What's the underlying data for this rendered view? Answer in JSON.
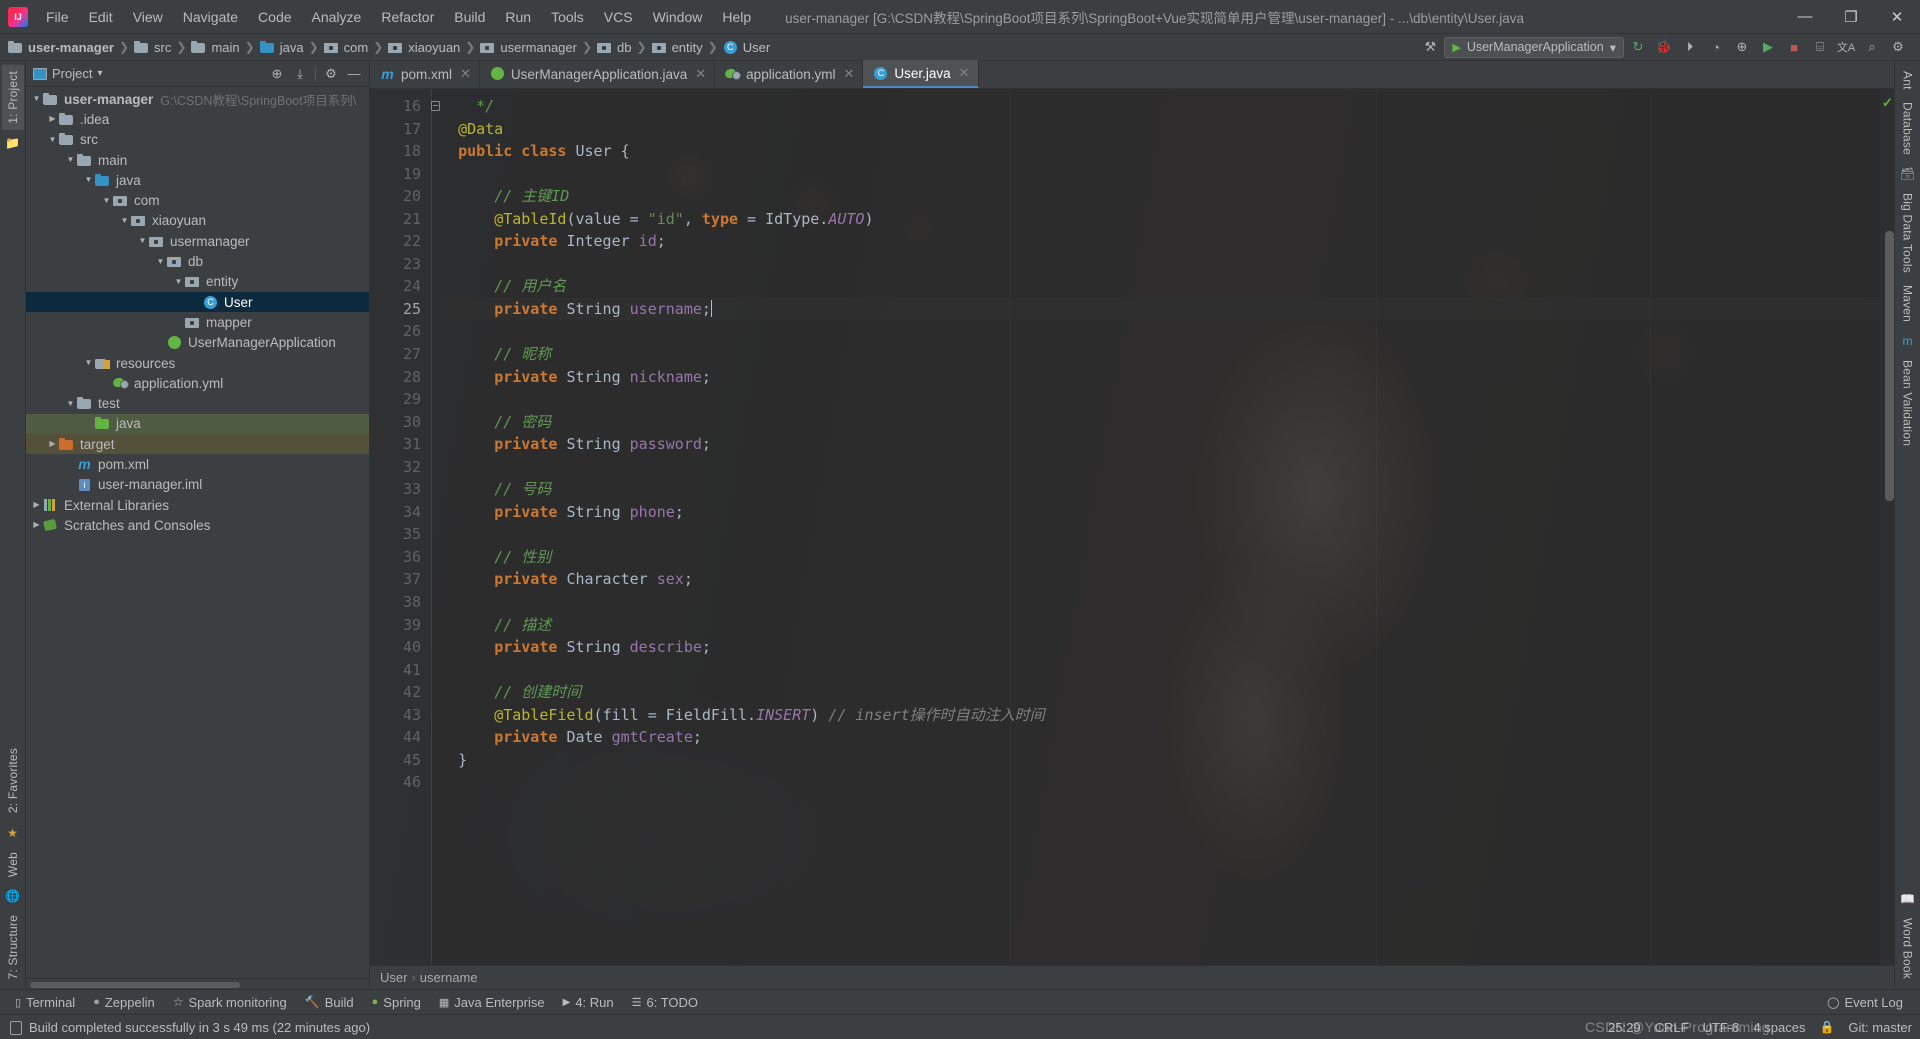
{
  "window": {
    "title": "user-manager [G:\\CSDN教程\\SpringBoot项目系列\\SpringBoot+Vue实现简单用户管理\\user-manager] - ...\\db\\entity\\User.java",
    "minimize_label": "—",
    "maximize_label": "❐",
    "close_label": "✕",
    "logo_name": "intellij-idea-logo"
  },
  "menu": [
    {
      "label": "File"
    },
    {
      "label": "Edit"
    },
    {
      "label": "View"
    },
    {
      "label": "Navigate"
    },
    {
      "label": "Code"
    },
    {
      "label": "Analyze"
    },
    {
      "label": "Refactor"
    },
    {
      "label": "Build"
    },
    {
      "label": "Run"
    },
    {
      "label": "Tools"
    },
    {
      "label": "VCS"
    },
    {
      "label": "Window"
    },
    {
      "label": "Help"
    }
  ],
  "breadcrumbs": [
    {
      "label": "user-manager",
      "icon": "folder-module",
      "bold": true
    },
    {
      "label": "src",
      "icon": "folder"
    },
    {
      "label": "main",
      "icon": "folder"
    },
    {
      "label": "java",
      "icon": "folder-source"
    },
    {
      "label": "com",
      "icon": "package"
    },
    {
      "label": "xiaoyuan",
      "icon": "package"
    },
    {
      "label": "usermanager",
      "icon": "package"
    },
    {
      "label": "db",
      "icon": "package"
    },
    {
      "label": "entity",
      "icon": "package"
    },
    {
      "label": "User",
      "icon": "class"
    }
  ],
  "toolbar": {
    "run_config": "UserManagerApplication",
    "run_config_caret": "▾",
    "icons": [
      {
        "name": "hammer-build-icon",
        "glyph": "⚒"
      },
      {
        "name": "update-project-icon",
        "glyph": "↻"
      },
      {
        "name": "debug-bug-icon",
        "glyph": "🐞"
      },
      {
        "name": "run-with-coverage-icon",
        "glyph": "⏵"
      },
      {
        "name": "profile-icon",
        "glyph": "◔"
      },
      {
        "name": "attach-process-icon",
        "glyph": "⊕"
      },
      {
        "name": "run-icon",
        "glyph": "▶"
      },
      {
        "name": "stop-icon",
        "glyph": "■"
      },
      {
        "name": "layout-icon",
        "glyph": "⌸"
      },
      {
        "name": "translate-icon",
        "glyph": "文A"
      },
      {
        "name": "search-everywhere-icon",
        "glyph": "⌕"
      },
      {
        "name": "settings-gear-icon",
        "glyph": "⚙"
      }
    ]
  },
  "left_strip": {
    "top_tabs": [
      {
        "label": "1: Project",
        "active": true
      }
    ],
    "bottom_tabs": [
      {
        "label": "2: Favorites"
      },
      {
        "label": "Web"
      },
      {
        "label": "7: Structure"
      }
    ]
  },
  "right_strip": {
    "tabs": [
      {
        "label": "Ant"
      },
      {
        "label": "Database"
      },
      {
        "label": "Big Data Tools"
      },
      {
        "label": "Maven"
      },
      {
        "label": "Bean Validation"
      }
    ],
    "bottom_tabs": [
      {
        "label": "Word Book"
      }
    ]
  },
  "project_panel": {
    "title": "Project",
    "title_caret": "▾",
    "actions": [
      {
        "name": "locate-target-icon",
        "glyph": "⊕"
      },
      {
        "name": "collapse-all-icon",
        "glyph": "⤓"
      },
      {
        "name": "settings-gear-icon",
        "glyph": "⚙"
      },
      {
        "name": "hide-panel-icon",
        "glyph": "—"
      }
    ],
    "tree": [
      {
        "depth": 0,
        "label": "user-manager",
        "path": "G:\\CSDN教程\\SpringBoot项目系列\\",
        "icon": "folder-module",
        "arrow": "▼",
        "bold": true
      },
      {
        "depth": 1,
        "label": ".idea",
        "icon": "folder",
        "arrow": "▶"
      },
      {
        "depth": 1,
        "label": "src",
        "icon": "folder",
        "arrow": "▼"
      },
      {
        "depth": 2,
        "label": "main",
        "icon": "folder",
        "arrow": "▼"
      },
      {
        "depth": 3,
        "label": "java",
        "icon": "folder-source",
        "arrow": "▼"
      },
      {
        "depth": 4,
        "label": "com",
        "icon": "package",
        "arrow": "▼"
      },
      {
        "depth": 5,
        "label": "xiaoyuan",
        "icon": "package",
        "arrow": "▼"
      },
      {
        "depth": 6,
        "label": "usermanager",
        "icon": "package",
        "arrow": "▼"
      },
      {
        "depth": 7,
        "label": "db",
        "icon": "package",
        "arrow": "▼"
      },
      {
        "depth": 8,
        "label": "entity",
        "icon": "package",
        "arrow": "▼"
      },
      {
        "depth": 9,
        "label": "User",
        "icon": "class",
        "arrow": "",
        "selected": true
      },
      {
        "depth": 8,
        "label": "mapper",
        "icon": "package",
        "arrow": ""
      },
      {
        "depth": 7,
        "label": "UserManagerApplication",
        "icon": "spring-class",
        "arrow": ""
      },
      {
        "depth": 3,
        "label": "resources",
        "icon": "folder-resources",
        "arrow": "▼"
      },
      {
        "depth": 4,
        "label": "application.yml",
        "icon": "spring-yml",
        "arrow": ""
      },
      {
        "depth": 2,
        "label": "test",
        "icon": "folder",
        "arrow": "▼"
      },
      {
        "depth": 3,
        "label": "java",
        "icon": "folder-test",
        "arrow": "",
        "highlight": "green"
      },
      {
        "depth": 1,
        "label": "target",
        "icon": "folder-excluded",
        "arrow": "▶",
        "highlight": "olive"
      },
      {
        "depth": 1,
        "label": "pom.xml",
        "icon": "maven",
        "arrow": ""
      },
      {
        "depth": 1,
        "label": "user-manager.iml",
        "icon": "iml",
        "arrow": ""
      },
      {
        "depth": 0,
        "label": "External Libraries",
        "icon": "library",
        "arrow": "▶"
      },
      {
        "depth": 0,
        "label": "Scratches and Consoles",
        "icon": "scratch",
        "arrow": "▶"
      }
    ]
  },
  "editor_tabs": [
    {
      "label": "pom.xml",
      "icon": "maven-icon",
      "active": false,
      "close": "✕"
    },
    {
      "label": "UserManagerApplication.java",
      "icon": "spring-class-icon",
      "active": false,
      "close": "✕"
    },
    {
      "label": "application.yml",
      "icon": "spring-yml-icon",
      "active": false,
      "close": "✕"
    },
    {
      "label": "User.java",
      "icon": "java-class-icon",
      "active": true,
      "close": "✕"
    }
  ],
  "editor": {
    "first_line_number": 16,
    "current_line": 25,
    "inspection_status_glyph": "✓",
    "lines": [
      {
        "n": 16,
        "fold": true,
        "tokens": [
          {
            "t": "    ",
            "c": "pl"
          },
          {
            "t": "*/",
            "c": "cm"
          }
        ]
      },
      {
        "n": 17,
        "tokens": [
          {
            "t": "  ",
            "c": "pl"
          },
          {
            "t": "@Data",
            "c": "an"
          }
        ]
      },
      {
        "n": 18,
        "tokens": [
          {
            "t": "  ",
            "c": "pl"
          },
          {
            "t": "public class ",
            "c": "k"
          },
          {
            "t": "User ",
            "c": "ty"
          },
          {
            "t": "{",
            "c": "pl"
          }
        ]
      },
      {
        "n": 19,
        "tokens": []
      },
      {
        "n": 20,
        "tokens": [
          {
            "t": "      ",
            "c": "pl"
          },
          {
            "t": "// 主键ID",
            "c": "cm"
          }
        ]
      },
      {
        "n": 21,
        "tokens": [
          {
            "t": "      ",
            "c": "pl"
          },
          {
            "t": "@TableId",
            "c": "an"
          },
          {
            "t": "(",
            "c": "pl"
          },
          {
            "t": "value",
            "c": "pl"
          },
          {
            "t": " = ",
            "c": "pl"
          },
          {
            "t": "\"id\"",
            "c": "st"
          },
          {
            "t": ", ",
            "c": "pl"
          },
          {
            "t": "type",
            "c": "k"
          },
          {
            "t": " = ",
            "c": "pl"
          },
          {
            "t": "IdType.",
            "c": "pl"
          },
          {
            "t": "AUTO",
            "c": "it"
          },
          {
            "t": ")",
            "c": "pl"
          }
        ]
      },
      {
        "n": 22,
        "tokens": [
          {
            "t": "      ",
            "c": "pl"
          },
          {
            "t": "private ",
            "c": "k"
          },
          {
            "t": "Integer ",
            "c": "ty"
          },
          {
            "t": "id",
            "c": "fd"
          },
          {
            "t": ";",
            "c": "pl"
          }
        ]
      },
      {
        "n": 23,
        "tokens": []
      },
      {
        "n": 24,
        "tokens": [
          {
            "t": "      ",
            "c": "pl"
          },
          {
            "t": "// 用户名",
            "c": "cm"
          }
        ]
      },
      {
        "n": 25,
        "current": true,
        "tokens": [
          {
            "t": "      ",
            "c": "pl"
          },
          {
            "t": "private ",
            "c": "k"
          },
          {
            "t": "String ",
            "c": "ty"
          },
          {
            "t": "username",
            "c": "fd"
          },
          {
            "t": ";",
            "c": "pl"
          }
        ],
        "caret": true
      },
      {
        "n": 26,
        "tokens": []
      },
      {
        "n": 27,
        "tokens": [
          {
            "t": "      ",
            "c": "pl"
          },
          {
            "t": "// 昵称",
            "c": "cm"
          }
        ]
      },
      {
        "n": 28,
        "tokens": [
          {
            "t": "      ",
            "c": "pl"
          },
          {
            "t": "private ",
            "c": "k"
          },
          {
            "t": "String ",
            "c": "ty"
          },
          {
            "t": "nickname",
            "c": "fd"
          },
          {
            "t": ";",
            "c": "pl"
          }
        ]
      },
      {
        "n": 29,
        "tokens": []
      },
      {
        "n": 30,
        "tokens": [
          {
            "t": "      ",
            "c": "pl"
          },
          {
            "t": "// 密码",
            "c": "cm"
          }
        ]
      },
      {
        "n": 31,
        "tokens": [
          {
            "t": "      ",
            "c": "pl"
          },
          {
            "t": "private ",
            "c": "k"
          },
          {
            "t": "String ",
            "c": "ty"
          },
          {
            "t": "password",
            "c": "fd"
          },
          {
            "t": ";",
            "c": "pl"
          }
        ]
      },
      {
        "n": 32,
        "tokens": []
      },
      {
        "n": 33,
        "tokens": [
          {
            "t": "      ",
            "c": "pl"
          },
          {
            "t": "// 号码",
            "c": "cm"
          }
        ]
      },
      {
        "n": 34,
        "tokens": [
          {
            "t": "      ",
            "c": "pl"
          },
          {
            "t": "private ",
            "c": "k"
          },
          {
            "t": "String ",
            "c": "ty"
          },
          {
            "t": "phone",
            "c": "fd"
          },
          {
            "t": ";",
            "c": "pl"
          }
        ]
      },
      {
        "n": 35,
        "tokens": []
      },
      {
        "n": 36,
        "tokens": [
          {
            "t": "      ",
            "c": "pl"
          },
          {
            "t": "// 性别",
            "c": "cm"
          }
        ]
      },
      {
        "n": 37,
        "tokens": [
          {
            "t": "      ",
            "c": "pl"
          },
          {
            "t": "private ",
            "c": "k"
          },
          {
            "t": "Character ",
            "c": "ty"
          },
          {
            "t": "sex",
            "c": "fd"
          },
          {
            "t": ";",
            "c": "pl"
          }
        ]
      },
      {
        "n": 38,
        "tokens": []
      },
      {
        "n": 39,
        "tokens": [
          {
            "t": "      ",
            "c": "pl"
          },
          {
            "t": "// 描述",
            "c": "cm"
          }
        ]
      },
      {
        "n": 40,
        "tokens": [
          {
            "t": "      ",
            "c": "pl"
          },
          {
            "t": "private ",
            "c": "k"
          },
          {
            "t": "String ",
            "c": "ty"
          },
          {
            "t": "describe",
            "c": "fd"
          },
          {
            "t": ";",
            "c": "pl"
          }
        ]
      },
      {
        "n": 41,
        "tokens": []
      },
      {
        "n": 42,
        "tokens": [
          {
            "t": "      ",
            "c": "pl"
          },
          {
            "t": "// 创建时间",
            "c": "cm"
          }
        ]
      },
      {
        "n": 43,
        "tokens": [
          {
            "t": "      ",
            "c": "pl"
          },
          {
            "t": "@TableField",
            "c": "an"
          },
          {
            "t": "(",
            "c": "pl"
          },
          {
            "t": "fill",
            "c": "pl"
          },
          {
            "t": " = ",
            "c": "pl"
          },
          {
            "t": "FieldFill.",
            "c": "pl"
          },
          {
            "t": "INSERT",
            "c": "it"
          },
          {
            "t": ") ",
            "c": "pl"
          },
          {
            "t": "// insert操作时自动注入时间",
            "c": "cmg"
          }
        ]
      },
      {
        "n": 44,
        "tokens": [
          {
            "t": "      ",
            "c": "pl"
          },
          {
            "t": "private ",
            "c": "k"
          },
          {
            "t": "Date ",
            "c": "ty"
          },
          {
            "t": "gmtCreate",
            "c": "fd"
          },
          {
            "t": ";",
            "c": "pl"
          }
        ]
      },
      {
        "n": 45,
        "tokens": [
          {
            "t": "  ",
            "c": "pl"
          },
          {
            "t": "}",
            "c": "pl"
          }
        ]
      },
      {
        "n": 46,
        "tokens": []
      }
    ],
    "breadcrumb": [
      {
        "label": "User"
      },
      {
        "label": "username"
      }
    ],
    "breadcrumb_sep": "›"
  },
  "tool_windows": [
    {
      "label": "Terminal",
      "icon": "terminal-icon",
      "glyph": "▣"
    },
    {
      "label": "Zeppelin",
      "icon": "zeppelin-icon",
      "glyph": "◗"
    },
    {
      "label": "Spark monitoring",
      "icon": "spark-icon",
      "glyph": "☆"
    },
    {
      "label": "Build",
      "icon": "hammer-icon",
      "glyph": "⚒"
    },
    {
      "label": "Spring",
      "icon": "spring-leaf-icon",
      "glyph": "◗"
    },
    {
      "label": "Java Enterprise",
      "icon": "java-ee-icon",
      "glyph": "▤"
    },
    {
      "label": "4: Run",
      "icon": "run-icon",
      "glyph": "▶",
      "mnemonic": "4"
    },
    {
      "label": "6: TODO",
      "icon": "todo-icon",
      "glyph": "☰",
      "mnemonic": "6"
    }
  ],
  "tool_windows_right": {
    "label": "Event Log",
    "glyph": "○"
  },
  "statusbar": {
    "message": "Build completed successfully in 3 s 49 ms (22 minutes ago)",
    "message_icon": "build-notification-icon",
    "caret_position": "25:29",
    "line_separator": "CRLF",
    "encoding": "UTF-8",
    "indent": "4 spaces",
    "lock_icon": "🔒",
    "branch": "Git: master"
  },
  "watermark": "CSDN @Yuan-Programming"
}
